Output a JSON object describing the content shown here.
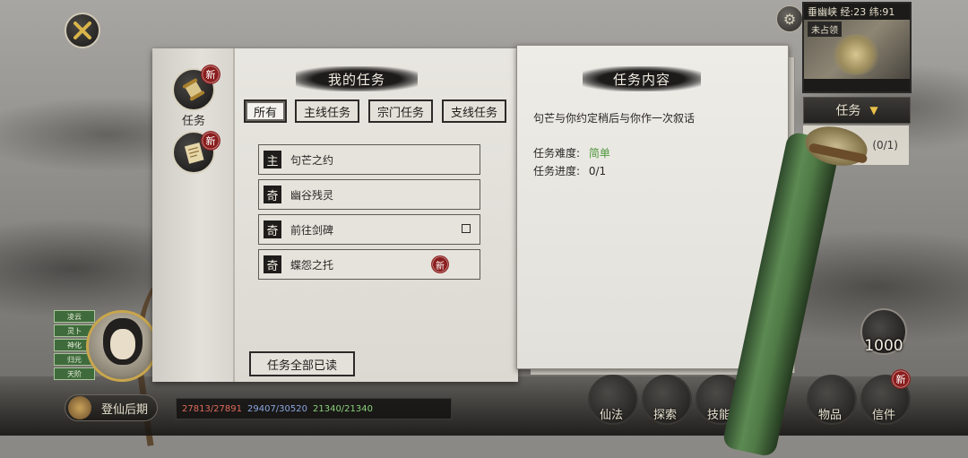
{
  "hud": {
    "minimap_title": "垂幽峡 经:23 纬:91",
    "minimap_location": "未占领",
    "task_dropdown_label": "任务",
    "side_quest_progress": "(0/1)",
    "orb_value": "1000",
    "realm_label": "登仙后期",
    "stats": {
      "hp": "27813/27891",
      "mp": "29407/30520",
      "xp": "21340/21340"
    },
    "bottom_buttons": [
      "仙法",
      "探索",
      "技能",
      "物品",
      "信件"
    ],
    "left_badges": [
      "凌云",
      "灵卜",
      "神化",
      "归元",
      "天阶"
    ]
  },
  "side_tabs": {
    "tasks_label": "任务",
    "new_badge": "新"
  },
  "quest_panel": {
    "title": "我的任务",
    "filters": [
      "所有",
      "主线任务",
      "宗门任务",
      "支线任务"
    ],
    "quests": [
      {
        "type": "主",
        "name": "句芒之约",
        "check": false,
        "new": false
      },
      {
        "type": "奇",
        "name": "幽谷残灵",
        "check": false,
        "new": false
      },
      {
        "type": "奇",
        "name": "前往剑碑",
        "check": true,
        "new": false
      },
      {
        "type": "奇",
        "name": "蝶怨之托",
        "check": false,
        "new": true
      }
    ],
    "mark_all_read": "任务全部已读"
  },
  "detail_panel": {
    "title": "任务内容",
    "description": "句芒与你约定稍后与你作一次叙话",
    "difficulty_label": "任务难度:",
    "difficulty_value": "简单",
    "progress_label": "任务进度:",
    "progress_value": "0/1"
  },
  "colors": {
    "difficulty_easy": "#4f9a3e",
    "new_badge": "#8a1e1e"
  }
}
